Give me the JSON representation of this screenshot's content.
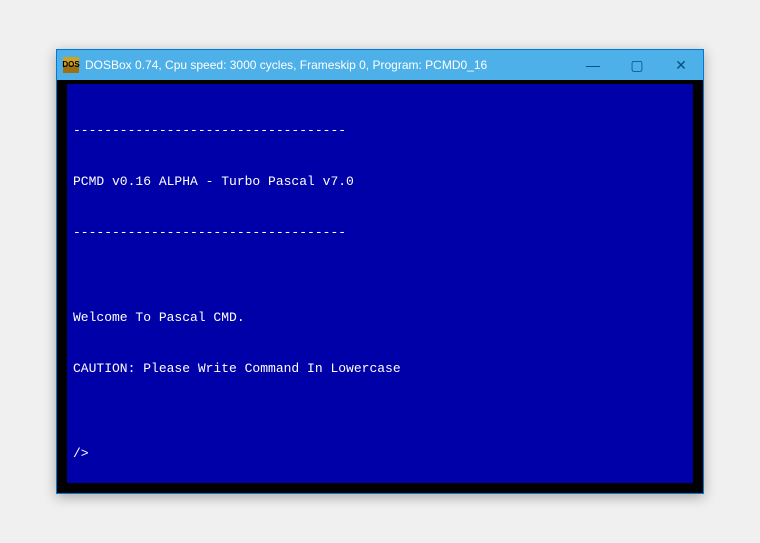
{
  "titlebar": {
    "text": "DOSBox 0.74, Cpu speed:    3000 cycles, Frameskip  0, Program: PCMD0_16",
    "icon_label": "DOS"
  },
  "window_controls": {
    "minimize": "—",
    "maximize": "▢",
    "close": "✕"
  },
  "terminal": {
    "lines": [
      "-----------------------------------",
      "PCMD v0.16 ALPHA - Turbo Pascal v7.0",
      "-----------------------------------",
      "",
      "Welcome To Pascal CMD.",
      "CAUTION: Please Write Command In Lowercase",
      "",
      "/>"
    ]
  }
}
